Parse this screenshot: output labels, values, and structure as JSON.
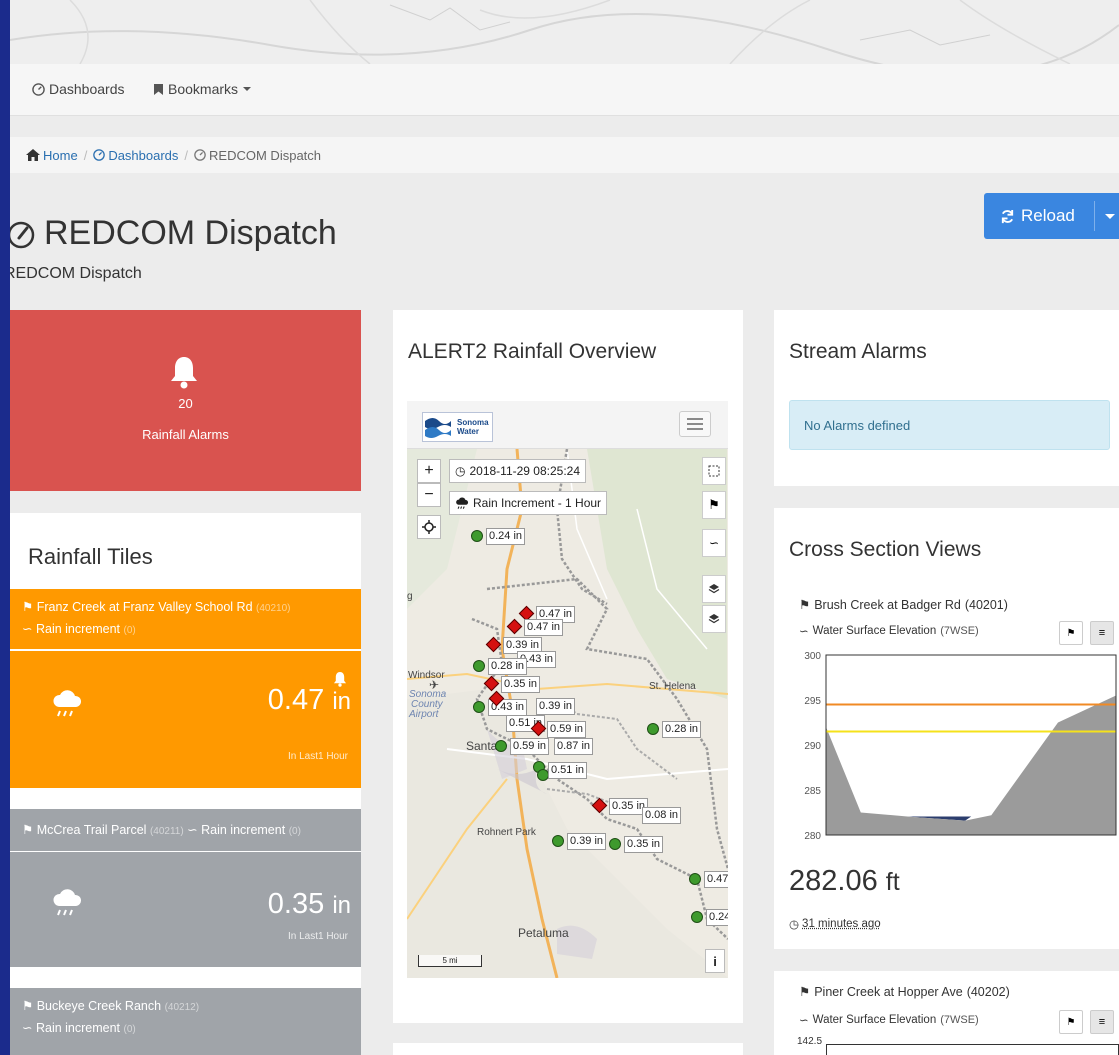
{
  "nav": {
    "dashboards": "Dashboards",
    "bookmarks": "Bookmarks"
  },
  "breadcrumb": {
    "home": "Home",
    "sep1": "/",
    "dashboards": "Dashboards",
    "sep2": "/",
    "current": "REDCOM Dispatch"
  },
  "page": {
    "title": "REDCOM Dispatch",
    "subtitle": "REDCOM Dispatch",
    "reload": "Reload"
  },
  "alarm_card": {
    "count": "20",
    "label": "Rainfall Alarms",
    "color": "#d9534f"
  },
  "rainfall_tiles": {
    "title": "Rainfall Tiles",
    "tiles": [
      {
        "site": "Franz Creek at Franz Valley School Rd",
        "site_id": "(40210)",
        "measure": "Rain increment",
        "measure_count": "(0)",
        "value": "0.47",
        "unit": "in",
        "period": "In Last1 Hour",
        "color": "#ff9900"
      },
      {
        "site": "McCrea Trail Parcel",
        "site_id": "(40211)",
        "measure": "Rain increment",
        "measure_count": "(0)",
        "value": "0.35",
        "unit": "in",
        "period": "In Last1 Hour",
        "color": "#a0a4a9"
      },
      {
        "site": "Buckeye Creek Ranch",
        "site_id": "(40212)",
        "measure": "Rain increment",
        "measure_count": "(0)",
        "color": "#a0a4a9"
      }
    ]
  },
  "map": {
    "title": "ALERT2 Rainfall Overview",
    "logo": {
      "line1": "Sonoma",
      "line2": "Water"
    },
    "timestamp": "2018-11-29 08:25:24",
    "layer": "Rain Increment - 1 Hour",
    "zoom_in": "+",
    "zoom_out": "−",
    "scale": "5 mi",
    "info": "i",
    "places": [
      "Windsor",
      "Sonoma",
      "County",
      "Airport",
      "St. Helena",
      "Santa",
      "Rohnert Park",
      "Petaluma",
      "g"
    ],
    "labels": [
      "0.24 in",
      "0.47 in",
      "0.47 in",
      "0.39 in",
      "0.43 in",
      "0.28 in",
      "0.35 in",
      "0.43 in",
      "0.39 in",
      "0.51 in",
      "0.59 in",
      "0.59 in",
      "0.87 in",
      "0.28 in",
      "0.51 in",
      "0.35 in",
      "0.08 in",
      "0.39 in",
      "0.35 in",
      "0.47",
      "0.24"
    ]
  },
  "stream_alarms": {
    "title": "Stream Alarms",
    "message": "No Alarms defined"
  },
  "cross_sections": {
    "title": "Cross Section Views",
    "first": {
      "site": "Brush Creek at Badger Rd",
      "site_id": "(40201)",
      "measure": "Water Surface Elevation",
      "code": "(7WSE)",
      "value": "282.06",
      "unit": "ft",
      "time": "31 minutes ago"
    },
    "second": {
      "site": "Piner Creek at Hopper Ave",
      "site_id": "(40202)",
      "measure": "Water Surface Elevation",
      "code": "(7WSE)",
      "y_top": "142.5"
    }
  },
  "chart_data": {
    "type": "area",
    "title": "",
    "xlabel": "",
    "ylabel": "",
    "ylim": [
      280,
      300
    ],
    "y_ticks": [
      "300",
      "295",
      "290",
      "285",
      "280"
    ],
    "x": [
      0,
      0.12,
      0.3,
      0.48,
      0.57,
      0.8,
      1.0
    ],
    "ground": [
      292,
      282.5,
      282,
      281.6,
      282.2,
      292.5,
      295.5
    ],
    "water_surface": 282.06,
    "threshold_lines": [
      {
        "value": 294.5,
        "color": "#f08a24"
      },
      {
        "value": 291.5,
        "color": "#f5e21b"
      }
    ],
    "ground_color": "#9b9b9b",
    "water_color": "#2c3e6e",
    "grid": false,
    "legend": "none"
  }
}
